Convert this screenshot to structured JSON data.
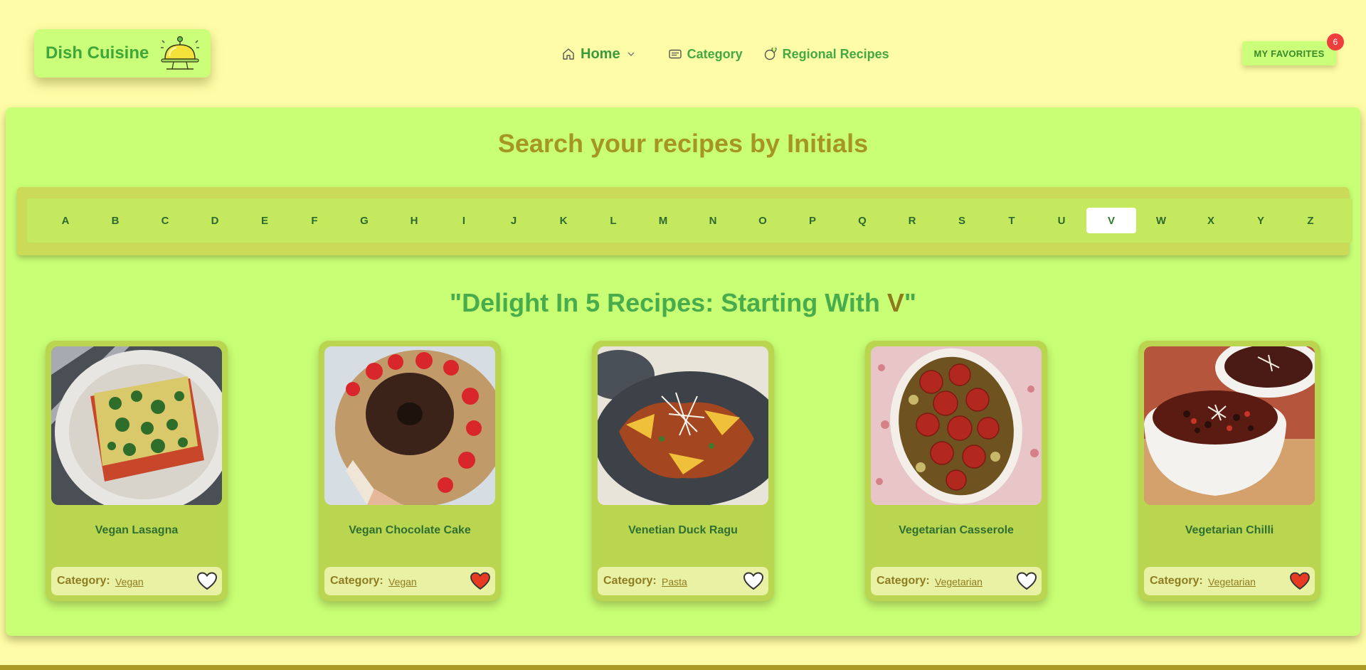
{
  "header": {
    "brand": "Dish Cuisine",
    "nav": {
      "home": "Home",
      "category": "Category",
      "regional": "Regional Recipes"
    },
    "favorites_label": "MY FAVORITES",
    "favorites_count": "6"
  },
  "search": {
    "title": "Search your recipes by Initials",
    "letters": [
      "A",
      "B",
      "C",
      "D",
      "E",
      "F",
      "G",
      "H",
      "I",
      "J",
      "K",
      "L",
      "M",
      "N",
      "O",
      "P",
      "Q",
      "R",
      "S",
      "T",
      "U",
      "V",
      "W",
      "X",
      "Y",
      "Z"
    ],
    "selected": "V"
  },
  "results": {
    "heading_prefix": "\"Delight In 5 Recipes: Starting With ",
    "heading_letter": "V",
    "heading_suffix": "\""
  },
  "recipes": [
    {
      "title": "Vegan Lasagna",
      "category_label": "Category:",
      "category": "Vegan",
      "favorited": false
    },
    {
      "title": "Vegan Chocolate Cake",
      "category_label": "Category:",
      "category": "Vegan",
      "favorited": true
    },
    {
      "title": "Venetian Duck Ragu",
      "category_label": "Category:",
      "category": "Pasta",
      "favorited": false
    },
    {
      "title": "Vegetarian Casserole",
      "category_label": "Category:",
      "category": "Vegetarian",
      "favorited": false
    },
    {
      "title": "Vegetarian Chilli",
      "category_label": "Category:",
      "category": "Vegetarian",
      "favorited": true
    }
  ],
  "colors": {
    "page_bg": "#fffca7",
    "panel_bg": "#c8ff75",
    "accent_green": "#48ac4c",
    "accent_olive": "#a59622",
    "heart_red": "#e63b22"
  }
}
